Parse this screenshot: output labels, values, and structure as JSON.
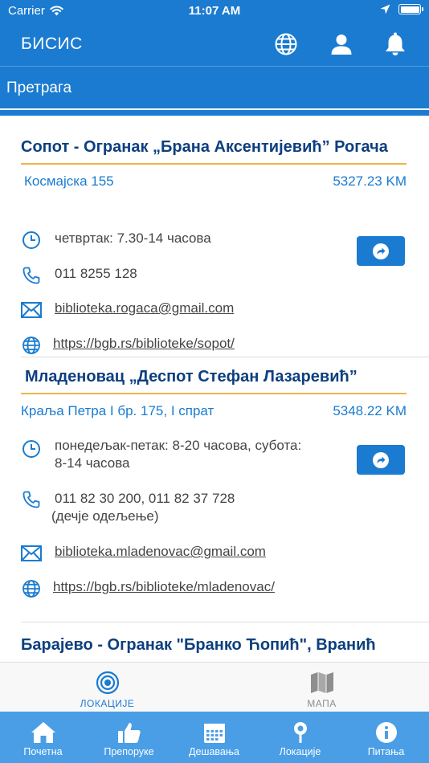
{
  "status_bar": {
    "carrier": "Carrier",
    "time": "11:07 AM"
  },
  "header": {
    "title": "БИСИС"
  },
  "search": {
    "placeholder": "Претрага"
  },
  "locations": [
    {
      "name": "Сопот - Огранак „Брана Аксентијевић” Рогача",
      "address": "Космајска 155",
      "distance": "5327.23 KM",
      "hours": "четвртак: 7.30-14 часова",
      "phone": "011 8255 128",
      "email": "biblioteka.rogaca@gmail.com",
      "website": "https://bgb.rs/biblioteke/sopot/"
    },
    {
      "name": "Младеновац „Деспот Стефан Лазаревић”",
      "address": "Краља Петра I бр. 175, I спрат",
      "distance": "5348.22 KM",
      "hours_line1": "понедељак-петак: 8-20 часова, субота:",
      "hours_line2": "8-14 часова",
      "phone": "011 82 30 200, 011 82 37 728",
      "phone_note": "(дечје одељење)",
      "email": "biblioteka.mladenovac@gmail.com",
      "website": "https://bgb.rs/biblioteke/mladenovac/"
    },
    {
      "name": "Барајево - Огранак \"Бранко Ћопић\", Вранић"
    }
  ],
  "view_switch": {
    "locations_label": "ЛОКАЦИЈЕ",
    "map_label": "МАПА"
  },
  "tabs": [
    {
      "label": "Почетна",
      "icon": "home-icon"
    },
    {
      "label": "Препоруке",
      "icon": "thumbs-up-icon"
    },
    {
      "label": "Дешавања",
      "icon": "calendar-icon"
    },
    {
      "label": "Локације",
      "icon": "pin-icon"
    },
    {
      "label": "Питања",
      "icon": "info-icon"
    }
  ],
  "colors": {
    "primary": "#1a7bd0",
    "title": "#0d3f7f",
    "accent_rule": "#f0b34a",
    "tabbar": "#4a9ee6"
  }
}
